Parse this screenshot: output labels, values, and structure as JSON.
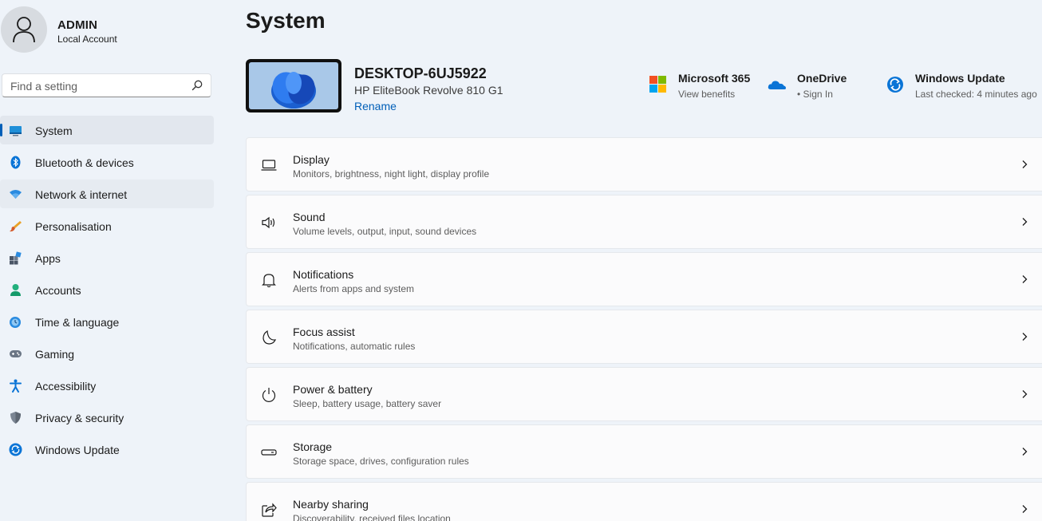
{
  "profile": {
    "name": "ADMIN",
    "account_type": "Local Account"
  },
  "search": {
    "placeholder": "Find a setting"
  },
  "sidebar": {
    "items": [
      {
        "label": "System"
      },
      {
        "label": "Bluetooth & devices"
      },
      {
        "label": "Network & internet"
      },
      {
        "label": "Personalisation"
      },
      {
        "label": "Apps"
      },
      {
        "label": "Accounts"
      },
      {
        "label": "Time & language"
      },
      {
        "label": "Gaming"
      },
      {
        "label": "Accessibility"
      },
      {
        "label": "Privacy & security"
      },
      {
        "label": "Windows Update"
      }
    ]
  },
  "page": {
    "title": "System"
  },
  "device": {
    "name": "DESKTOP-6UJ5922",
    "model": "HP EliteBook Revolve 810 G1",
    "rename_label": "Rename"
  },
  "quick": {
    "m365": {
      "title": "Microsoft 365",
      "subtitle": "View benefits"
    },
    "onedrive": {
      "title": "OneDrive",
      "subtitle": "• Sign In"
    },
    "update": {
      "title": "Windows Update",
      "subtitle": "Last checked: 4 minutes ago"
    }
  },
  "cards": [
    {
      "title": "Display",
      "subtitle": "Monitors, brightness, night light, display profile"
    },
    {
      "title": "Sound",
      "subtitle": "Volume levels, output, input, sound devices"
    },
    {
      "title": "Notifications",
      "subtitle": "Alerts from apps and system"
    },
    {
      "title": "Focus assist",
      "subtitle": "Notifications, automatic rules"
    },
    {
      "title": "Power & battery",
      "subtitle": "Sleep, battery usage, battery saver"
    },
    {
      "title": "Storage",
      "subtitle": "Storage space, drives, configuration rules"
    },
    {
      "title": "Nearby sharing",
      "subtitle": "Discoverability, received files location"
    }
  ],
  "colors": {
    "accent": "#005fb8",
    "background": "#eef3f9",
    "card": "#fbfbfc"
  }
}
